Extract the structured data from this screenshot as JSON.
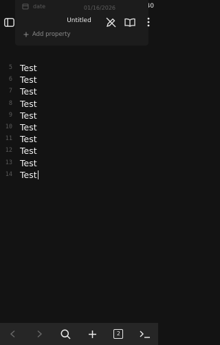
{
  "status": {
    "time": "13:40",
    "battery": "67"
  },
  "properties": {
    "date_label": "date",
    "date_value": "01/16/2026",
    "add_label": "Add property"
  },
  "header": {
    "title": "Untitled"
  },
  "editor": {
    "lines": [
      {
        "num": "5",
        "text": "Test"
      },
      {
        "num": "6",
        "text": "Test"
      },
      {
        "num": "7",
        "text": "Test"
      },
      {
        "num": "8",
        "text": "Test"
      },
      {
        "num": "9",
        "text": "Test"
      },
      {
        "num": "10",
        "text": "Test"
      },
      {
        "num": "11",
        "text": "Test"
      },
      {
        "num": "12",
        "text": "Test"
      },
      {
        "num": "13",
        "text": "Test"
      },
      {
        "num": "14",
        "text": "Test"
      }
    ]
  },
  "bottombar": {
    "tab_count": "2"
  },
  "icons": {
    "sidebar": "sidebar-toggle-icon",
    "edit_toggle": "pencil-off-icon",
    "reading": "book-open-icon",
    "menu": "more-vertical-icon",
    "back": "arrow-left-icon",
    "forward": "arrow-right-icon",
    "search": "search-icon",
    "new": "plus-icon",
    "tabs": "tabs-icon",
    "command": "terminal-icon"
  }
}
